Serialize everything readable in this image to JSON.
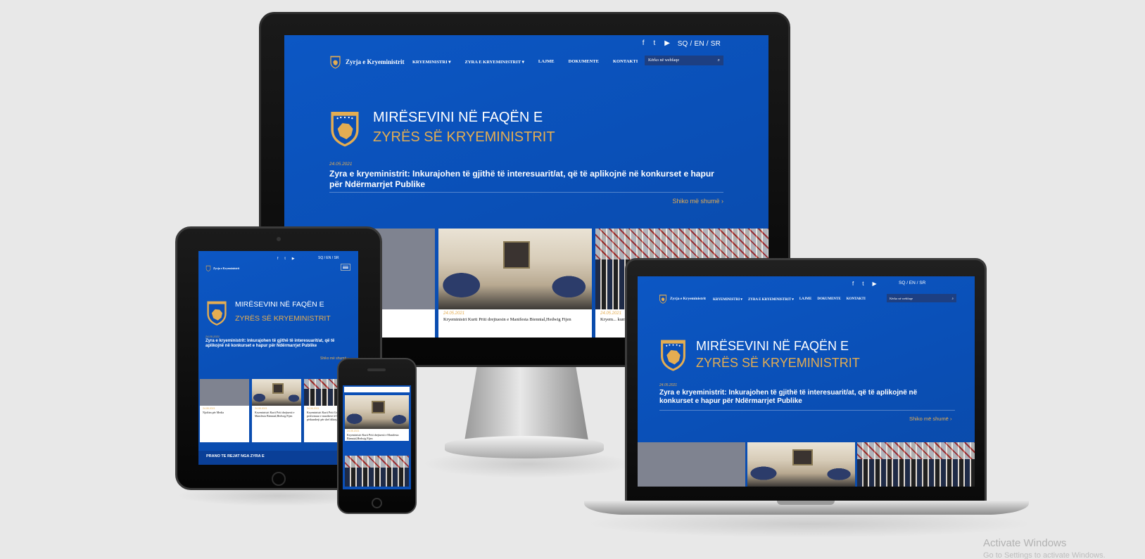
{
  "site": {
    "lang": [
      "SQ",
      "EN",
      "SR"
    ],
    "lang_text": "SQ /  EN /  SR",
    "brand": "Zyrja e Kryeministrit",
    "nav": [
      {
        "label": "KRYEMINISTRI",
        "dropdown": true
      },
      {
        "label": "ZYRA E KRYEMINISTRIT",
        "dropdown": true
      },
      {
        "label": "LAJME",
        "dropdown": false
      },
      {
        "label": "DOKUMENTE",
        "dropdown": false
      },
      {
        "label": "KONTAKTI",
        "dropdown": false
      }
    ],
    "nav_labels": {
      "kryeministri": "KRYEMINISTRI ▾",
      "zyra": "ZYRA E KRYEMINISTRIT ▾",
      "lajme": "LAJME",
      "dokumente": "DOKUMENTE",
      "kontakti": "KONTAKTI"
    },
    "search_placeholder": "Kërko në webfaqe",
    "welcome_line1": "MIRËSEVINI NË FAQËN E",
    "welcome_line2": "ZYRËS SË KRYEMINISTRIT",
    "featured_date": "24.05.2021",
    "featured_headline": "Zyra e kryeministrit: Inkurajohen të gjithë të interesuarit/at, që të aplikojnë në konkurset e hapur për Ndërmarrjet Publike",
    "more_link": "Shiko më shumë ›",
    "cards": [
      {
        "date": "24.05.2021",
        "text": "Njoftim për Media"
      },
      {
        "date": "24.05.2021",
        "text": "Kryeministri Kurti Priti drejtuesit e Manifesta Biennial,Hedwig Fijen"
      },
      {
        "date": "24.05.2021",
        "text": "Kryeministri Kurti Priti drejtuesit e Manifesta"
      }
    ],
    "desktop_card_text": "Kryeministri Kurti Priti drejtuesin e Manifesta Biennial,Hedwig Fijen",
    "desktop_card3_text": "Kryem... kumar...",
    "tablet_card1_text": "Njoftim për Media",
    "tablet_card2_text": "Kryeministri Kurti Priti drejtuesit e Manifesta Biennial,Hedwig Fijen",
    "tablet_card3_text": "Kryeministri Kurti Priti Grupin e të performuar e muzikeve të botuara, përkundrejt për shef dikteja",
    "tablet_footer": "PRANO TE REJAT NGA ZYRA E",
    "phone_card_text": "Kryeministri Kurti Priti drejtuesit e Manifesta Biennial,Hedwig Fijen"
  },
  "icons": {
    "facebook": "f",
    "twitter": "t",
    "youtube": "▶",
    "search": "⌕"
  },
  "colors": {
    "primary_blue": "#0b4fb6",
    "gold": "#e4ad52",
    "search_bg": "#1d3f82"
  },
  "watermark": {
    "line1": "Activate Windows",
    "line2": "Go to Settings to activate Windows."
  }
}
